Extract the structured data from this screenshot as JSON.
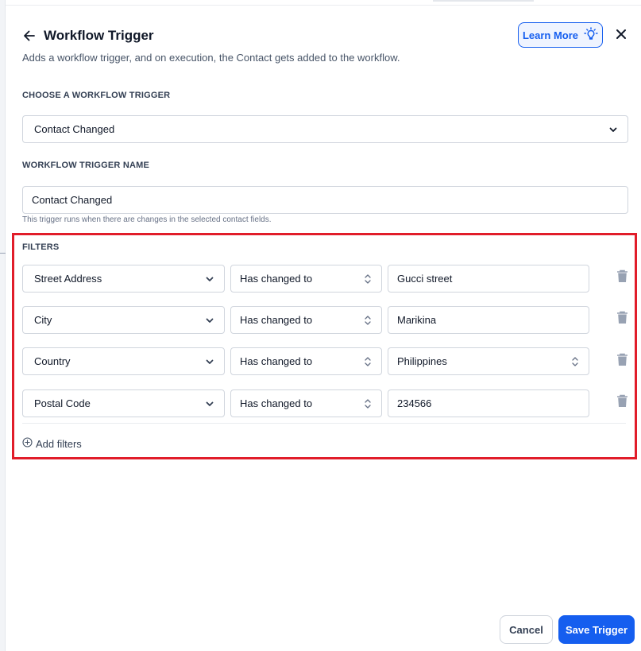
{
  "header": {
    "title": "Workflow Trigger",
    "subtitle": "Adds a workflow trigger, and on execution, the Contact gets added to the workflow.",
    "learn_more_label": "Learn More"
  },
  "trigger": {
    "choose_label": "CHOOSE A WORKFLOW TRIGGER",
    "selected": "Contact Changed"
  },
  "trigger_name": {
    "label": "WORKFLOW TRIGGER NAME",
    "value": "Contact Changed",
    "hint": "This trigger runs when there are changes in the selected contact fields."
  },
  "filters": {
    "label": "FILTERS",
    "rows": [
      {
        "field": "Street Address",
        "operator": "Has changed to",
        "value": "Gucci street"
      },
      {
        "field": "City",
        "operator": "Has changed to",
        "value": "Marikina"
      },
      {
        "field": "Country",
        "operator": "Has changed to",
        "value": "Philippines"
      },
      {
        "field": "Postal Code",
        "operator": "Has changed to",
        "value": "234566"
      }
    ],
    "add_label": "Add filters"
  },
  "footer": {
    "cancel_label": "Cancel",
    "save_label": "Save Trigger"
  },
  "colors": {
    "primary": "#155eef",
    "highlight_border": "#e11d2a",
    "trash": "#98a2b3"
  },
  "icons": [
    "arrow-left-icon",
    "lightbulb-icon",
    "close-icon",
    "chevron-down-icon",
    "chevron-up-down-icon",
    "trash-icon",
    "plus-circle-icon"
  ]
}
